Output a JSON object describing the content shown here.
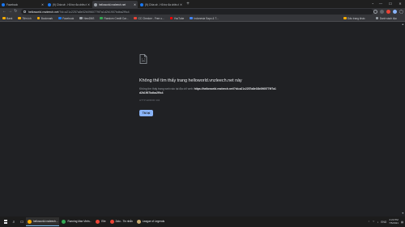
{
  "tabs": [
    {
      "label": "Facebook",
      "color": "#1877f2",
      "active": false
    },
    {
      "label": "(9) Chia sẻ - Hỗ trợ đa chiều từ thành viên",
      "color": "#1877f2",
      "active": false
    },
    {
      "label": "helloworld.vnzleech.net",
      "color": "#9aa0a6",
      "active": true
    },
    {
      "label": "(9) Chia sẻ - Hỗ trợ đa chiều từ thành viên",
      "color": "#1877f2",
      "active": false
    }
  ],
  "address": {
    "host": "helloworld.vnzleech.net",
    "path": "/?id=a21c2257a8e02b0960779f7a1d2b1907bdba2f9c4"
  },
  "bookmarks": [
    {
      "label": "Bank",
      "color": "#f9ab00"
    },
    {
      "label": "Tiện ích",
      "color": "#f9ab00"
    },
    {
      "label": "Bookmark",
      "color": "#f9ab00"
    },
    {
      "label": "Facebook",
      "color": "#1877f2"
    },
    {
      "label": "NewDNS",
      "color": "#9aa0a6"
    },
    {
      "label": "Random Credit Car...",
      "color": "#34a853"
    },
    {
      "label": "CC Checker - Free o...",
      "color": "#ea4335"
    },
    {
      "label": "YouTube",
      "color": "#ff0000"
    },
    {
      "label": "Indonesia Sapo & T...",
      "color": "#4285f4"
    }
  ],
  "bookmarks_right": [
    "Dấu trang khác",
    "Danh sách đọc"
  ],
  "error": {
    "title": "Không thể tìm thấy trang helloworld.vnzleech.net này",
    "body_prefix": "Không tìm thấy trang web nào tại địa chỉ web:",
    "body_url": "https://helloworld.vnzleech.net/?id=a21c2257a8e02b0960779f7a1d2b1907bdba2f9c4",
    "code": "HTTP ERROR 404",
    "reload_label": "Tải lại"
  },
  "taskbar": {
    "tasks": [
      {
        "label": "helloworld.vnzleech...",
        "color": "#f9ab00",
        "active": true
      },
      {
        "label": "Running Man Vietn...",
        "color": "#34a853",
        "active": false
      },
      {
        "label": "Elle",
        "color": "#ea4335",
        "active": false
      },
      {
        "label": "Zalo - Tin nhắn",
        "color": "#ea4335",
        "active": false
      },
      {
        "label": "League of Legends",
        "color": "#c8aa6e",
        "active": false
      }
    ],
    "language": "ENG",
    "time": "2:22 PM",
    "date": "7/5/2021"
  }
}
